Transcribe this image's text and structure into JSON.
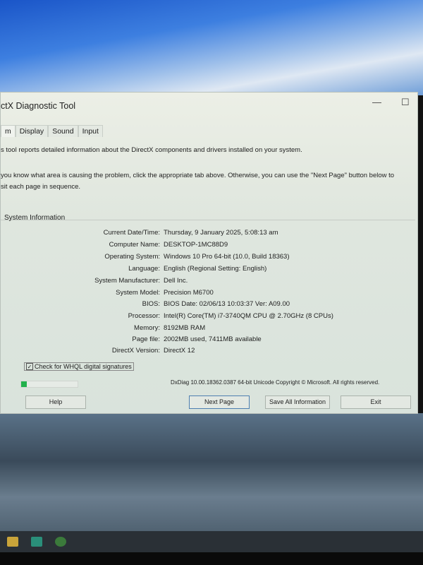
{
  "window": {
    "title": "ctX Diagnostic Tool",
    "minimize_icon": "minimize-icon",
    "maximize_icon": "maximize-icon"
  },
  "tabs": [
    {
      "label": "m"
    },
    {
      "label": "Display"
    },
    {
      "label": "Sound"
    },
    {
      "label": "Input"
    }
  ],
  "intro": "s tool reports detailed information about the DirectX components and drivers installed on your system.",
  "help_line1": "you know what area is causing the problem, click the appropriate tab above.  Otherwise, you can use the \"Next Page\" button below to",
  "help_line2": "sit each page in sequence.",
  "group_label": "System Information",
  "info": [
    {
      "k": "Current Date/Time:",
      "v": "Thursday, 9 January 2025, 5:08:13 am"
    },
    {
      "k": "Computer Name:",
      "v": "DESKTOP-1MC88D9"
    },
    {
      "k": "Operating System:",
      "v": "Windows 10 Pro 64-bit (10.0, Build 18363)"
    },
    {
      "k": "Language:",
      "v": "English (Regional Setting: English)"
    },
    {
      "k": "System Manufacturer:",
      "v": "Dell Inc."
    },
    {
      "k": "System Model:",
      "v": "Precision M6700"
    },
    {
      "k": "BIOS:",
      "v": "BIOS Date: 02/06/13 10:03:37 Ver: A09.00"
    },
    {
      "k": "Processor:",
      "v": "Intel(R) Core(TM) i7-3740QM CPU @ 2.70GHz (8 CPUs)"
    },
    {
      "k": "Memory:",
      "v": "8192MB RAM"
    },
    {
      "k": "Page file:",
      "v": "2002MB used, 7411MB available"
    },
    {
      "k": "DirectX Version:",
      "v": "DirectX 12"
    }
  ],
  "whql": {
    "label": "Check for WHQL digital signatures",
    "checked": true
  },
  "progress_percent": 10,
  "version_text": "DxDiag 10.00.18362.0387 64-bit Unicode  Copyright © Microsoft. All rights reserved.",
  "buttons": {
    "help": "Help",
    "next": "Next Page",
    "save": "Save All Information",
    "exit": "Exit"
  },
  "colors": {
    "progress": "#22b14c",
    "default_button_border": "#4e7fb0"
  }
}
